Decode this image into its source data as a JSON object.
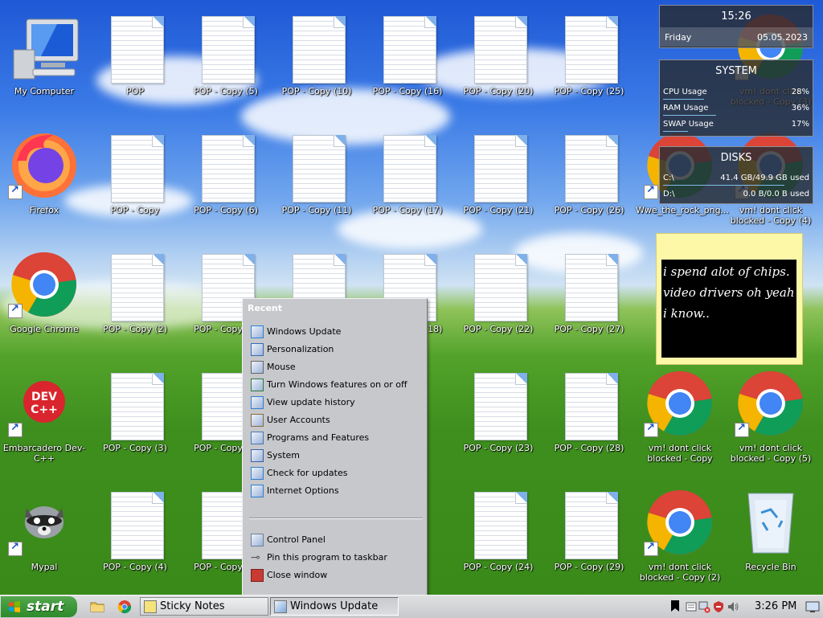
{
  "desktop": {
    "icons": [
      {
        "label": "My Computer",
        "type": "computer"
      },
      {
        "label": "Firefox",
        "type": "firefox"
      },
      {
        "label": "Google Chrome",
        "type": "chrome"
      },
      {
        "label": "Embarcadero Dev-C++",
        "type": "devcpp"
      },
      {
        "label": "Mypal",
        "type": "mypal"
      },
      {
        "label": "POP"
      },
      {
        "label": "POP - Copy"
      },
      {
        "label": "POP - Copy (2)"
      },
      {
        "label": "POP - Copy (3)"
      },
      {
        "label": "POP - Copy (4)"
      },
      {
        "label": "POP - Copy (5)"
      },
      {
        "label": "POP - Copy (6)"
      },
      {
        "label": "POP - Copy (7)"
      },
      {
        "label": "POP - Copy (8)"
      },
      {
        "label": "POP - Copy (9)"
      },
      {
        "label": "POP - Copy (10)"
      },
      {
        "label": "POP - Copy (11)"
      },
      {
        "label": "POP - Copy (15)"
      },
      {
        "label": "POP - Copy (16)"
      },
      {
        "label": "POP - Copy (17)"
      },
      {
        "label": "POP - Copy (18)"
      },
      {
        "label": "POP - Copy (19)"
      },
      {
        "label": "POP - Copy (20)"
      },
      {
        "label": "POP - Copy (21)"
      },
      {
        "label": "POP - Copy (22)"
      },
      {
        "label": "POP - Copy (23)"
      },
      {
        "label": "POP - Copy (24)"
      },
      {
        "label": "POP - Copy (25)"
      },
      {
        "label": "POP - Copy (26)"
      },
      {
        "label": "POP - Copy (27)"
      },
      {
        "label": "POP - Copy (28)"
      },
      {
        "label": "POP - Copy (29)"
      },
      {
        "label": "Wwe_the_rock_png..."
      },
      {
        "label": "vm! dont click blocked - Copy"
      },
      {
        "label": "vm! dont click blocked - Copy (2)"
      },
      {
        "label": "vm! dont click blocked - Copy (3)"
      },
      {
        "label": "vm! dont click blocked - Copy (4)"
      },
      {
        "label": "vm! dont click blocked - Copy (5)"
      },
      {
        "label": "Recycle Bin"
      }
    ]
  },
  "clock_widget": {
    "time": "15:26",
    "day": "Friday",
    "date": "05.05.2023"
  },
  "system_widget": {
    "title": "SYSTEM",
    "rows": [
      {
        "label": "CPU Usage",
        "value": "28%",
        "level": 0.28
      },
      {
        "label": "RAM Usage",
        "value": "36%",
        "level": 0.36
      },
      {
        "label": "SWAP Usage",
        "value": "17%",
        "level": 0.17
      }
    ]
  },
  "disks_widget": {
    "title": "DISKS",
    "rows": [
      {
        "label": "C:\\",
        "value": "41.4 GB/49.9 GB used",
        "level": 0.83
      },
      {
        "label": "D:\\",
        "value": "0.0 B/0.0 B used",
        "level": 0
      }
    ]
  },
  "sticky_note": {
    "lines": [
      "i spend alot of chips.",
      "video drivers oh yeah",
      "i know.."
    ]
  },
  "jumplist": {
    "header": "Recent",
    "recent": [
      "Windows Update",
      "Personalization",
      "Mouse",
      "Turn Windows features on or off",
      "View update history",
      "User Accounts",
      "Programs and Features",
      "System",
      "Check for updates",
      "Internet Options"
    ],
    "tasks": [
      "Control Panel",
      "Pin this program to taskbar",
      "Close window"
    ]
  },
  "taskbar": {
    "start_label": "start",
    "buttons": [
      {
        "label": "Sticky Notes",
        "active": false
      },
      {
        "label": "Windows Update",
        "active": true
      }
    ],
    "clock": "3:26 PM"
  }
}
